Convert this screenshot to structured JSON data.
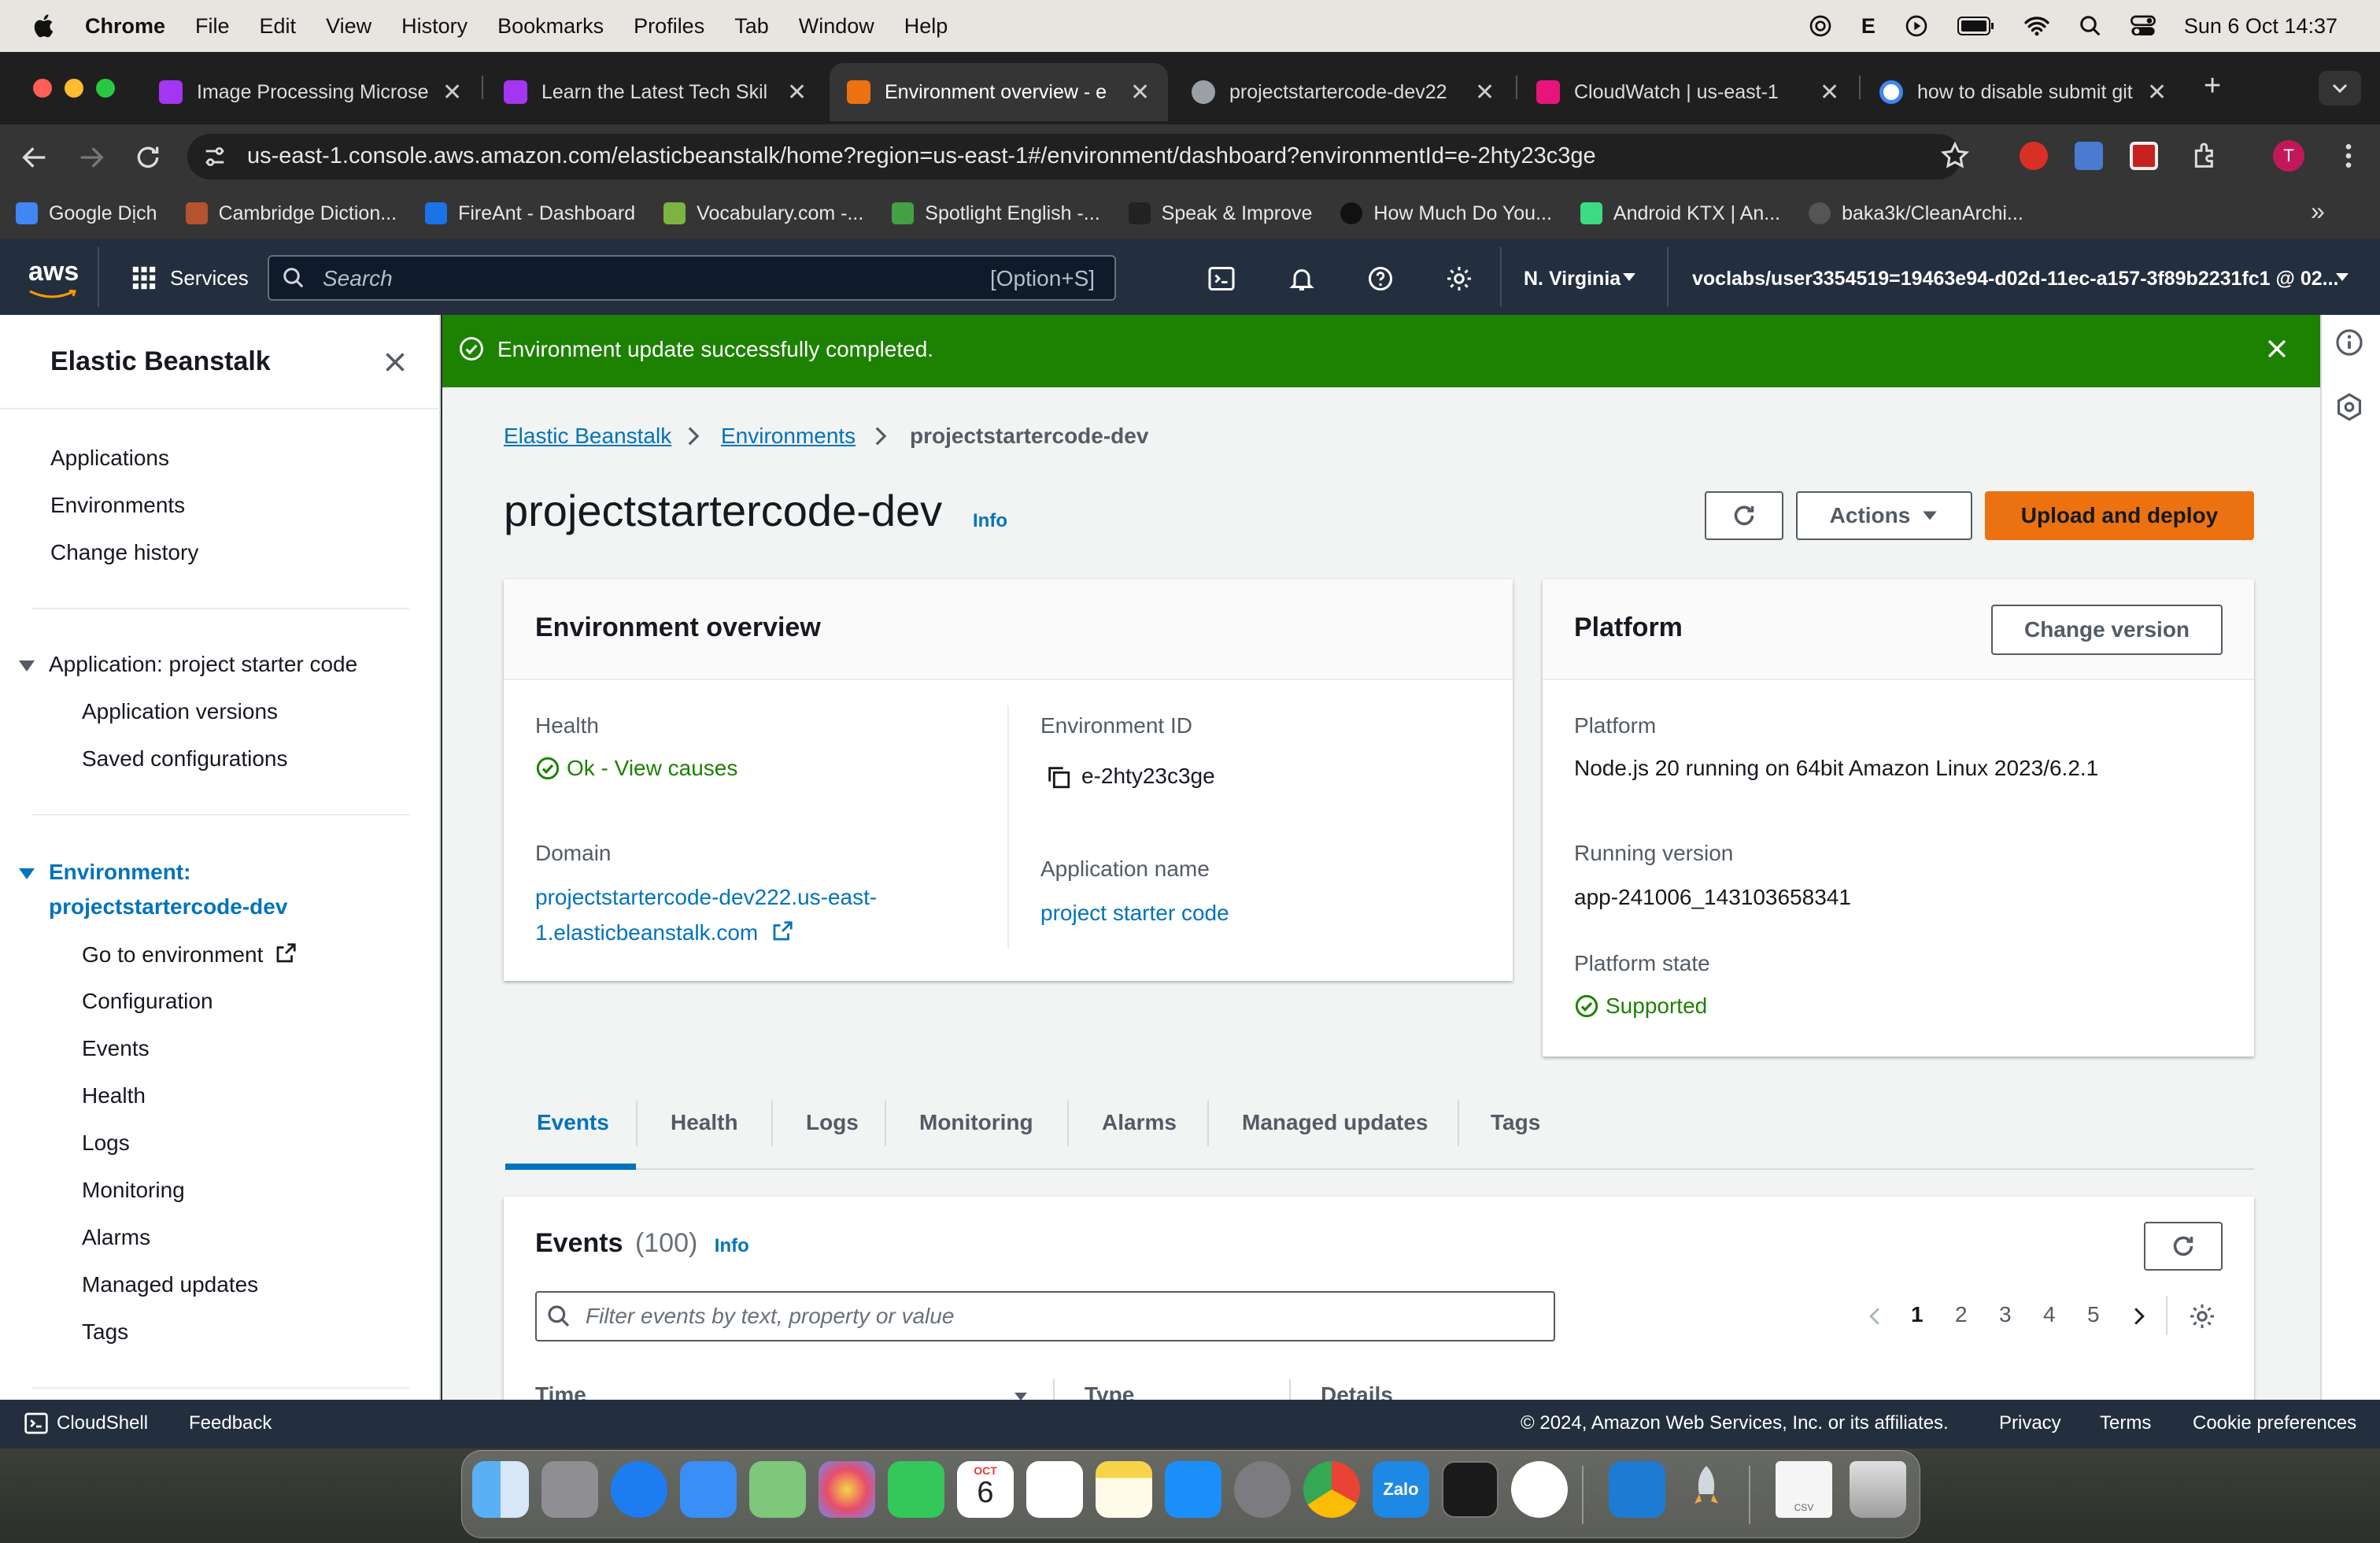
{
  "menubar": {
    "app": "Chrome",
    "items": [
      "File",
      "Edit",
      "View",
      "History",
      "Bookmarks",
      "Profiles",
      "Tab",
      "Window",
      "Help"
    ],
    "clock": "Sun 6 Oct  14:37",
    "input_indicator": "E"
  },
  "tabs": [
    {
      "title": "Image Processing Microse",
      "active": false
    },
    {
      "title": "Learn the Latest Tech Skil",
      "active": false
    },
    {
      "title": "Environment overview - e",
      "active": true
    },
    {
      "title": "projectstartercode-dev22",
      "active": false
    },
    {
      "title": "CloudWatch | us-east-1",
      "active": false
    },
    {
      "title": "how to disable submit git",
      "active": false
    }
  ],
  "address": {
    "url": "us-east-1.console.aws.amazon.com/elasticbeanstalk/home?region=us-east-1#/environment/dashboard?environmentId=e-2hty23c3ge",
    "profile_initial": "T"
  },
  "bookmarks": [
    "Google Dịch",
    "Cambridge Diction...",
    "FireAnt - Dashboard",
    "Vocabulary.com -...",
    "Spotlight English -...",
    "Speak & Improve",
    "How Much Do You...",
    "Android KTX  |  An...",
    "baka3k/CleanArchi..."
  ],
  "awsnav": {
    "logo": "aws",
    "services": "Services",
    "search_placeholder": "Search",
    "search_shortcut": "[Option+S]",
    "region": "N. Virginia",
    "account": "voclabs/user3354519=19463e94-d02d-11ec-a157-3f89b2231fc1 @ 02..."
  },
  "sidebar": {
    "title": "Elastic Beanstalk",
    "top_links": [
      "Applications",
      "Environments",
      "Change history"
    ],
    "application_section": "Application: project starter code",
    "application_links": [
      "Application versions",
      "Saved configurations"
    ],
    "environment_section_line1": "Environment:",
    "environment_section_line2": "projectstartercode-dev",
    "environment_links": [
      "Go to environment",
      "Configuration",
      "Events",
      "Health",
      "Logs",
      "Monitoring",
      "Alarms",
      "Managed updates",
      "Tags"
    ]
  },
  "flash": {
    "message": "Environment update successfully completed."
  },
  "breadcrumb": {
    "root": "Elastic Beanstalk",
    "middle": "Environments",
    "current": "projectstartercode-dev"
  },
  "page": {
    "title": "projectstartercode-dev",
    "info": "Info",
    "actions_label": "Actions",
    "upload_label": "Upload and deploy"
  },
  "overview": {
    "heading": "Environment overview",
    "health_label": "Health",
    "health_value": "Ok - View causes",
    "env_id_label": "Environment ID",
    "env_id_value": "e-2hty23c3ge",
    "domain_label": "Domain",
    "domain_line1": "projectstartercode-dev222.us-east-",
    "domain_line2": "1.elasticbeanstalk.com",
    "app_name_label": "Application name",
    "app_name_value": "project starter code"
  },
  "platform": {
    "heading": "Platform",
    "change_version_label": "Change version",
    "platform_label": "Platform",
    "platform_value": "Node.js 20 running on 64bit Amazon Linux 2023/6.2.1",
    "running_label": "Running version",
    "running_value": "app-241006_143103658341",
    "state_label": "Platform state",
    "state_value": "Supported"
  },
  "detail_tabs": [
    "Events",
    "Health",
    "Logs",
    "Monitoring",
    "Alarms",
    "Managed updates",
    "Tags"
  ],
  "events": {
    "heading": "Events",
    "count": "(100)",
    "info": "Info",
    "filter_placeholder": "Filter events by text, property or value",
    "pages": [
      "1",
      "2",
      "3",
      "4",
      "5"
    ],
    "columns": [
      "Time",
      "Type",
      "Details"
    ]
  },
  "footer": {
    "cloudshell": "CloudShell",
    "feedback": "Feedback",
    "copyright": "© 2024, Amazon Web Services, Inc. or its affiliates.",
    "privacy": "Privacy",
    "terms": "Terms",
    "cookies": "Cookie preferences"
  },
  "dock": {
    "calendar_month": "OCT",
    "calendar_day": "6",
    "zalo": "Zalo",
    "csv": "CSV"
  },
  "colors": {
    "aws_nav": "#232f3e",
    "success": "#1d8102",
    "link": "#0073bb",
    "primary_button": "#ec7211"
  }
}
